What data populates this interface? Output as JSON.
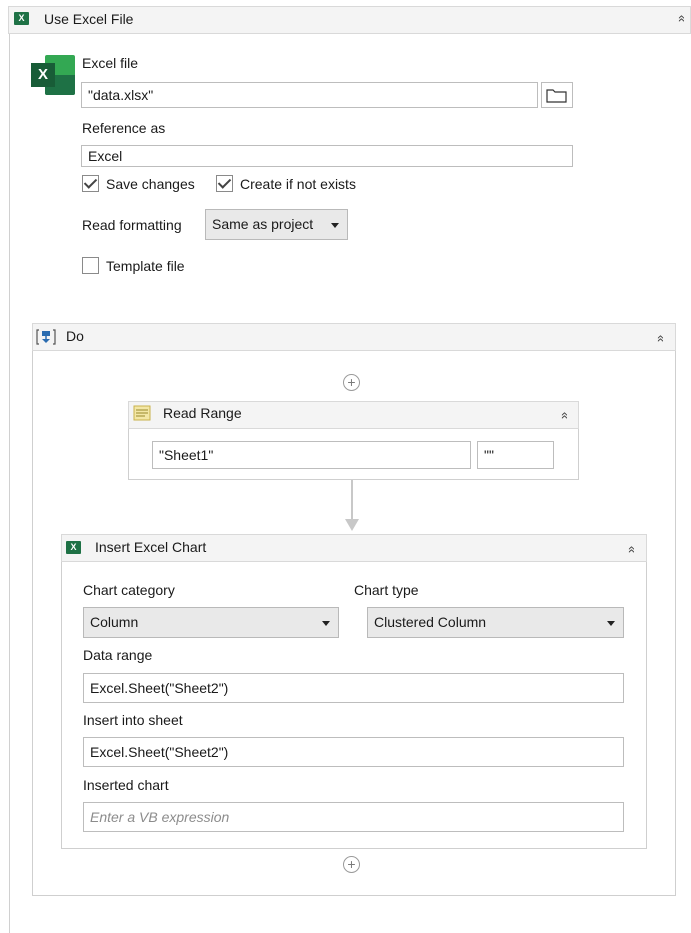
{
  "use_excel_file": {
    "title": "Use Excel File",
    "collapse_glyph": "»",
    "excel_file_label": "Excel file",
    "excel_file_value": "\"data.xlsx\"",
    "reference_as_label": "Reference as",
    "reference_as_value": "Excel",
    "save_changes_label": "Save changes",
    "save_changes_checked": true,
    "create_if_not_exists_label": "Create if not exists",
    "create_if_not_exists_checked": true,
    "read_formatting_label": "Read formatting",
    "read_formatting_value": "Same as project",
    "template_file_label": "Template file",
    "template_file_checked": false
  },
  "do_sequence": {
    "title": "Do"
  },
  "read_range": {
    "title": "Read Range",
    "sheet_value": "\"Sheet1\"",
    "range_value": "\"\""
  },
  "insert_excel_chart": {
    "title": "Insert Excel Chart",
    "chart_category_label": "Chart category",
    "chart_category_value": "Column",
    "chart_type_label": "Chart type",
    "chart_type_value": "Clustered Column",
    "data_range_label": "Data range",
    "data_range_value": "Excel.Sheet(\"Sheet2\")",
    "insert_into_sheet_label": "Insert into sheet",
    "insert_into_sheet_value": "Excel.Sheet(\"Sheet2\")",
    "inserted_chart_label": "Inserted chart",
    "inserted_chart_placeholder": "Enter a VB expression"
  },
  "icons": {
    "excel_letter": "X",
    "plus_glyph": "+"
  },
  "colors": {
    "excel_green": "#1e7145",
    "do_icon_blue": "#2b6cb0"
  }
}
